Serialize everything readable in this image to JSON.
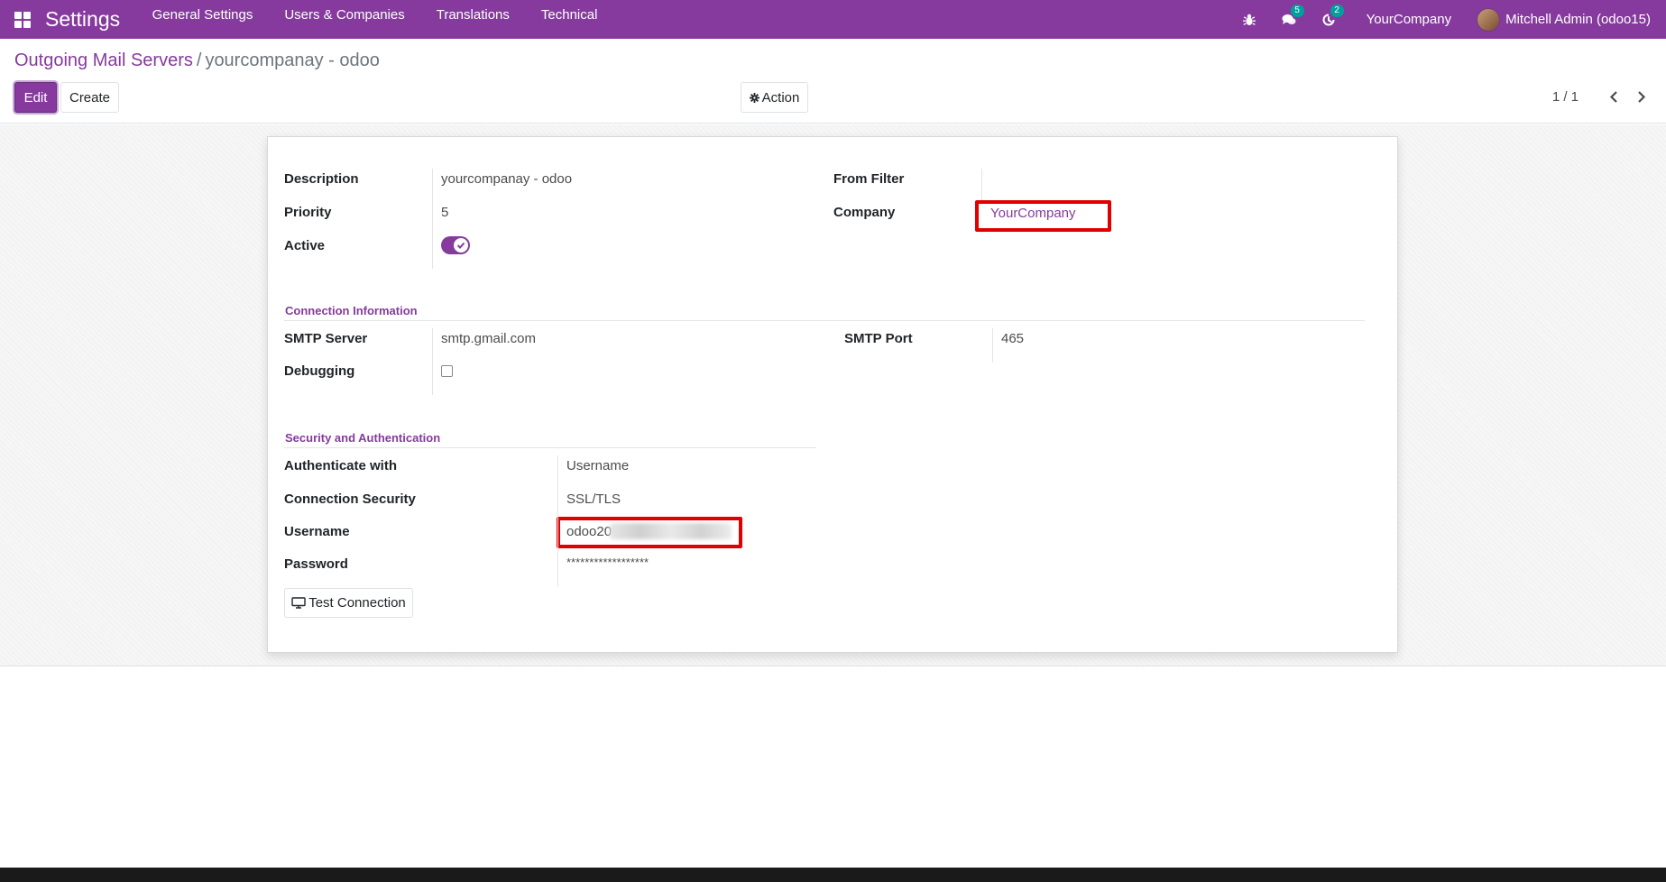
{
  "navbar": {
    "app_title": "Settings",
    "menu": [
      "General Settings",
      "Users & Companies",
      "Translations",
      "Technical"
    ],
    "messages_count": "5",
    "activities_count": "2",
    "company": "YourCompany",
    "user": "Mitchell Admin (odoo15)",
    "bg_color": "#863a9e"
  },
  "breadcrumb": {
    "parent": "Outgoing Mail Servers",
    "separator": "/",
    "current": "yourcompanay - odoo"
  },
  "toolbar": {
    "edit_label": "Edit",
    "create_label": "Create",
    "action_label": "Action",
    "pager": "1 / 1"
  },
  "form": {
    "description_label": "Description",
    "description_value": "yourcompanay - odoo",
    "priority_label": "Priority",
    "priority_value": "5",
    "active_label": "Active",
    "active_value": true,
    "from_filter_label": "From Filter",
    "from_filter_value": "",
    "company_label": "Company",
    "company_value": "YourCompany",
    "connection_section": "Connection Information",
    "smtp_server_label": "SMTP Server",
    "smtp_server_value": "smtp.gmail.com",
    "smtp_port_label": "SMTP Port",
    "smtp_port_value": "465",
    "debugging_label": "Debugging",
    "debugging_value": false,
    "security_section": "Security and Authentication",
    "auth_label": "Authenticate with",
    "auth_value": "Username",
    "conn_security_label": "Connection Security",
    "conn_security_value": "SSL/TLS",
    "username_label": "Username",
    "username_value": "odoo20",
    "password_label": "Password",
    "password_value": "******************",
    "test_button": "Test Connection"
  },
  "colors": {
    "accent": "#863a9e",
    "highlight_box": "#e00000",
    "badge": "#00a09d"
  }
}
